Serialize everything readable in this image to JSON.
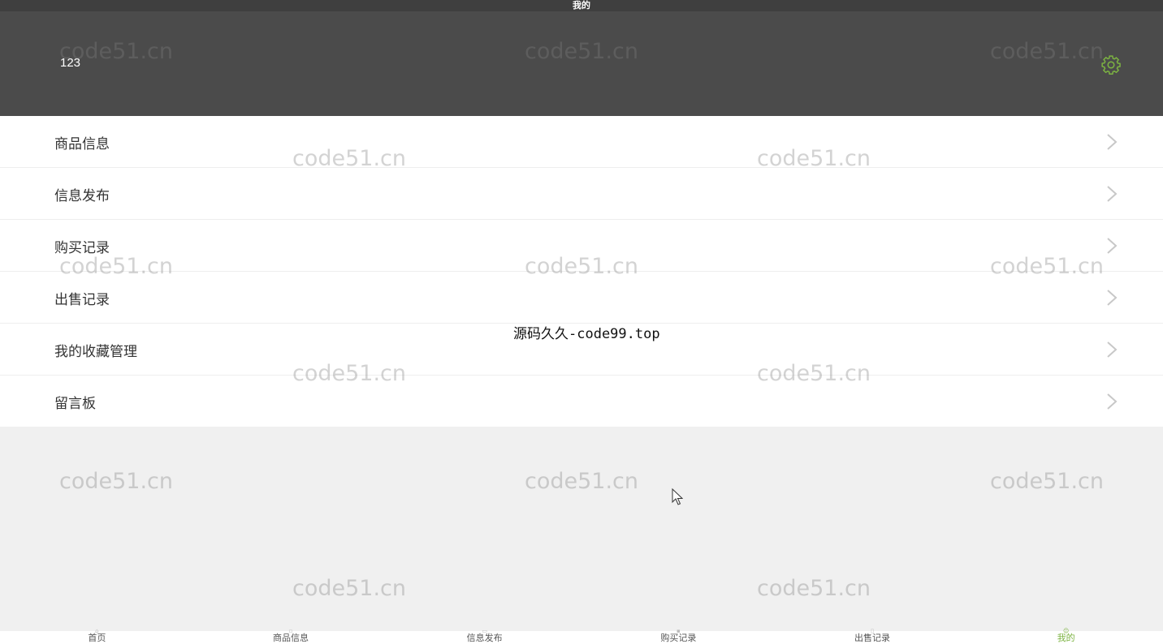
{
  "topbar": {
    "title": "我的"
  },
  "header": {
    "username": "123",
    "settings_icon": "gear-icon",
    "accent_color": "#7cb342"
  },
  "menu": {
    "items": [
      {
        "label": "商品信息"
      },
      {
        "label": "信息发布"
      },
      {
        "label": "购买记录"
      },
      {
        "label": "出售记录"
      },
      {
        "label": "我的收藏管理"
      },
      {
        "label": "留言板"
      }
    ]
  },
  "banner": {
    "text": "源码久久-code99.top"
  },
  "watermark": {
    "text": "code51.cn"
  },
  "tabbar": {
    "tabs": [
      {
        "label": "首页",
        "icon": "home-icon"
      },
      {
        "label": "商品信息",
        "icon": "goods-icon"
      },
      {
        "label": "信息发布",
        "icon": "publish-icon"
      },
      {
        "label": "购买记录",
        "icon": "cart-icon"
      },
      {
        "label": "出售记录",
        "icon": "sale-icon"
      },
      {
        "label": "我的",
        "icon": "user-icon"
      }
    ],
    "active_index": 5
  }
}
